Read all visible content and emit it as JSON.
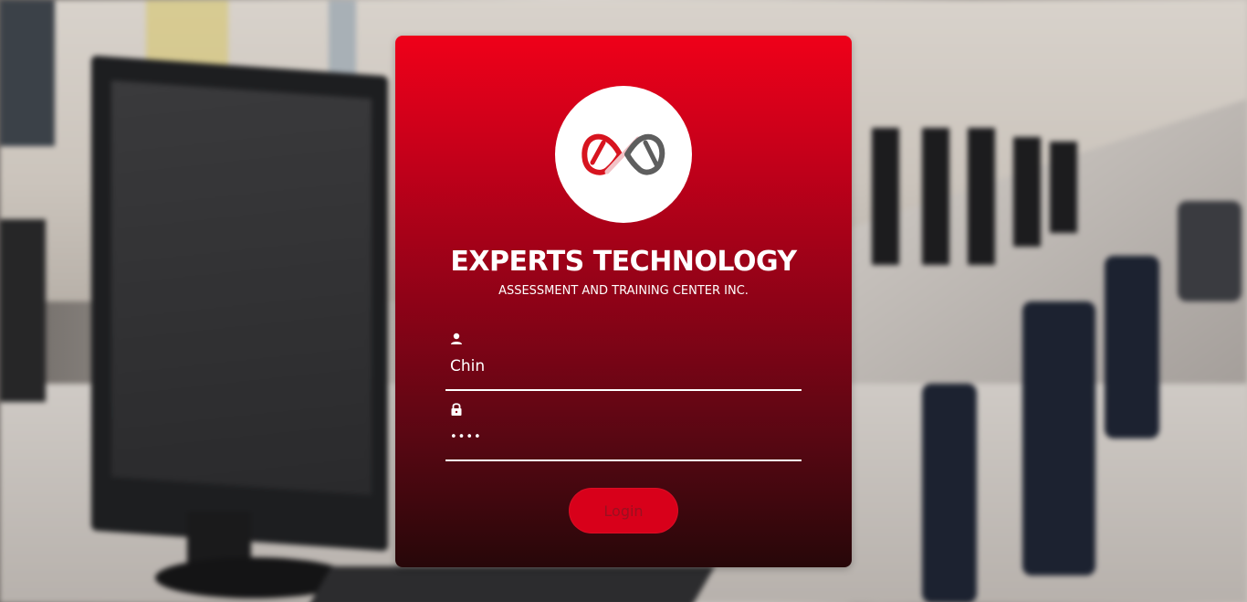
{
  "brand": {
    "title": "EXPERTS TECHNOLOGY",
    "subtitle": "ASSESSMENT AND TRAINING CENTER INC.",
    "logo_icon": "infinity-logo-icon"
  },
  "form": {
    "username": {
      "icon": "user-icon",
      "value": "Chin"
    },
    "password": {
      "icon": "lock-icon",
      "value": "••••"
    },
    "login_label": "Login"
  },
  "colors": {
    "card_top": "#ef0019",
    "card_bottom": "#270709",
    "button": "#d8001a",
    "button_text": "#9a1020",
    "logo_red": "#d7141f",
    "logo_gray": "#5e5e5e"
  }
}
